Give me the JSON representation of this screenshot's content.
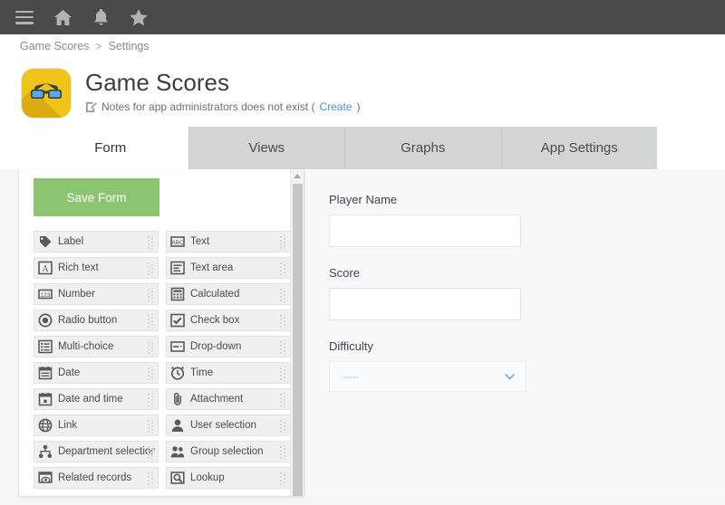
{
  "topbar": {
    "icons": [
      {
        "name": "hamburger-menu-icon",
        "label": "Menu"
      },
      {
        "name": "home-icon",
        "label": "Home"
      },
      {
        "name": "bell-icon",
        "label": "Notifications"
      },
      {
        "name": "star-icon",
        "label": "Favorites"
      }
    ],
    "background": "#4a4a4a"
  },
  "breadcrumb": {
    "items": [
      "Game Scores",
      "Settings"
    ],
    "separator": ">"
  },
  "app": {
    "title": "Game Scores",
    "icon_name": "glasses-app-icon",
    "icon_color": "#f0c419",
    "note_text": "Notes for app administrators does not exist (",
    "note_link": "Create",
    "note_suffix": ")"
  },
  "tabs": [
    {
      "label": "Form",
      "active": true
    },
    {
      "label": "Views",
      "active": false
    },
    {
      "label": "Graphs",
      "active": false
    },
    {
      "label": "App Settings",
      "active": false
    }
  ],
  "palette": {
    "save_label": "Save Form",
    "save_color": "#8cc571",
    "fields": [
      {
        "label": "Label",
        "icon": "tag-icon"
      },
      {
        "label": "Text",
        "icon": "abc-text-icon"
      },
      {
        "label": "Rich text",
        "icon": "rich-text-icon"
      },
      {
        "label": "Text area",
        "icon": "text-area-icon"
      },
      {
        "label": "Number",
        "icon": "number-123-icon"
      },
      {
        "label": "Calculated",
        "icon": "calculator-icon"
      },
      {
        "label": "Radio button",
        "icon": "radio-button-icon"
      },
      {
        "label": "Check box",
        "icon": "check-box-icon"
      },
      {
        "label": "Multi-choice",
        "icon": "multi-choice-icon"
      },
      {
        "label": "Drop-down",
        "icon": "drop-down-icon"
      },
      {
        "label": "Date",
        "icon": "calendar-icon"
      },
      {
        "label": "Time",
        "icon": "clock-icon"
      },
      {
        "label": "Date and time",
        "icon": "date-time-icon"
      },
      {
        "label": "Attachment",
        "icon": "paperclip-icon"
      },
      {
        "label": "Link",
        "icon": "globe-icon"
      },
      {
        "label": "User selection",
        "icon": "user-icon"
      },
      {
        "label": "Department selection",
        "icon": "org-chart-icon"
      },
      {
        "label": "Group selection",
        "icon": "group-users-icon"
      },
      {
        "label": "Related records",
        "icon": "related-records-icon"
      },
      {
        "label": "Lookup",
        "icon": "magnifier-lookup-icon"
      }
    ],
    "scrollbar": {
      "arrow": "scroll-up-arrow-icon"
    }
  },
  "form_preview": {
    "fields": [
      {
        "label": "Player Name",
        "type": "text",
        "value": "",
        "name": "player-name-field"
      },
      {
        "label": "Score",
        "type": "text",
        "value": "",
        "name": "score-field"
      },
      {
        "label": "Difficulty",
        "type": "select",
        "value": "-----",
        "name": "difficulty-field"
      }
    ]
  }
}
